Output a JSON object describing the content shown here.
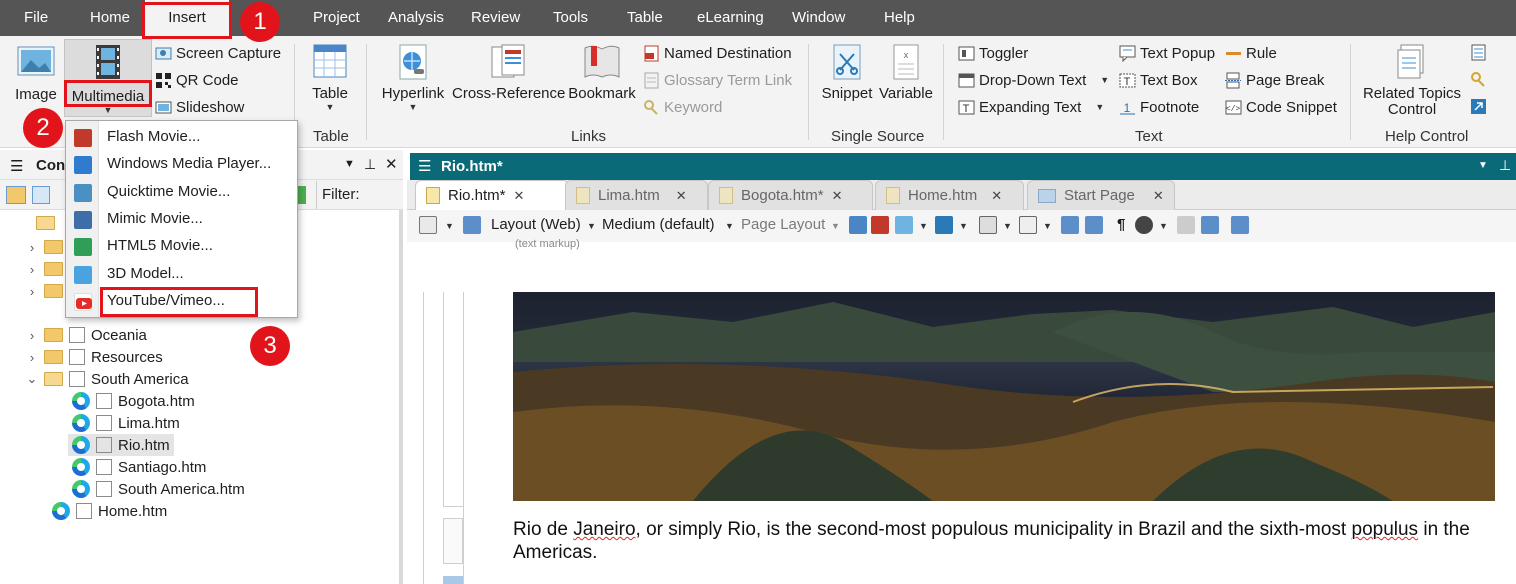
{
  "menubar": {
    "items": [
      "File",
      "Home",
      "Insert",
      "Project",
      "Analysis",
      "Review",
      "Tools",
      "Table",
      "eLearning",
      "Window",
      "Help"
    ],
    "active": "Insert"
  },
  "ribbon": {
    "image": "Image",
    "multimedia": "Multimedia",
    "screen_capture": "Screen Capture",
    "qr_code": "QR Code",
    "slideshow": "Slideshow",
    "table": "Table",
    "table_group": "Table",
    "hyperlink": "Hyperlink",
    "cross_reference": "Cross-Reference",
    "bookmark": "Bookmark",
    "named_destination": "Named Destination",
    "glossary_term_link": "Glossary Term Link",
    "keyword": "Keyword",
    "links_group": "Links",
    "snippet": "Snippet",
    "variable": "Variable",
    "single_source_group": "Single Source",
    "toggler": "Toggler",
    "drop_down_text": "Drop-Down Text",
    "expanding_text": "Expanding Text",
    "text_popup": "Text Popup",
    "text_box": "Text Box",
    "footnote": "Footnote",
    "rule": "Rule",
    "page_break": "Page Break",
    "code_snippet": "Code Snippet",
    "text_group": "Text",
    "related_topics_line1": "Related Topics",
    "related_topics_line2": "Control",
    "help_control_group": "Help Control"
  },
  "multimedia_menu": {
    "items": [
      {
        "label": "Flash Movie...",
        "color": "#c0392b"
      },
      {
        "label": "Windows Media Player...",
        "color": "#2e7bcf"
      },
      {
        "label": "Quicktime Movie...",
        "color": "#4a90c2"
      },
      {
        "label": "Mimic Movie...",
        "color": "#3e6ea8"
      },
      {
        "label": "HTML5 Movie...",
        "color": "#2f9e57"
      },
      {
        "label": "3D Model...",
        "color": "#4aa3df"
      },
      {
        "label": "YouTube/Vimeo...",
        "color": "#e52d27"
      }
    ]
  },
  "content_pane": {
    "title": "Con",
    "filter_label": "Filter:",
    "tree": [
      {
        "label": "Oceania",
        "type": "folder"
      },
      {
        "label": "Resources",
        "type": "folder"
      },
      {
        "label": "South America",
        "type": "folder-open"
      },
      {
        "label": "Bogota.htm",
        "type": "file"
      },
      {
        "label": "Lima.htm",
        "type": "file"
      },
      {
        "label": "Rio.htm",
        "type": "file",
        "selected": true
      },
      {
        "label": "Santiago.htm",
        "type": "file"
      },
      {
        "label": "South America.htm",
        "type": "file"
      },
      {
        "label": "Home.htm",
        "type": "file"
      }
    ]
  },
  "editor": {
    "title": "Rio.htm*",
    "tabs": [
      {
        "label": "Rio.htm*",
        "active": true
      },
      {
        "label": "Lima.htm",
        "active": false
      },
      {
        "label": "Bogota.htm*",
        "active": false
      },
      {
        "label": "Home.htm",
        "active": false
      },
      {
        "label": "Start Page",
        "active": false
      }
    ],
    "toolbar": {
      "layout": "Layout (Web)",
      "medium": "Medium (default)",
      "page_layout": "Page Layout"
    },
    "markup_hint": "(text markup)",
    "para_parts": [
      "Rio de ",
      "Janeiro",
      ", or simply Rio, is the second-most populous municipality in Brazil and the sixth-most ",
      "populus",
      " in the Americas."
    ]
  },
  "callouts": [
    "1",
    "2",
    "3"
  ],
  "colors": {
    "menubar_bg": "#555555",
    "title_bar": "#0a6a78",
    "highlight": "#e2141b"
  }
}
